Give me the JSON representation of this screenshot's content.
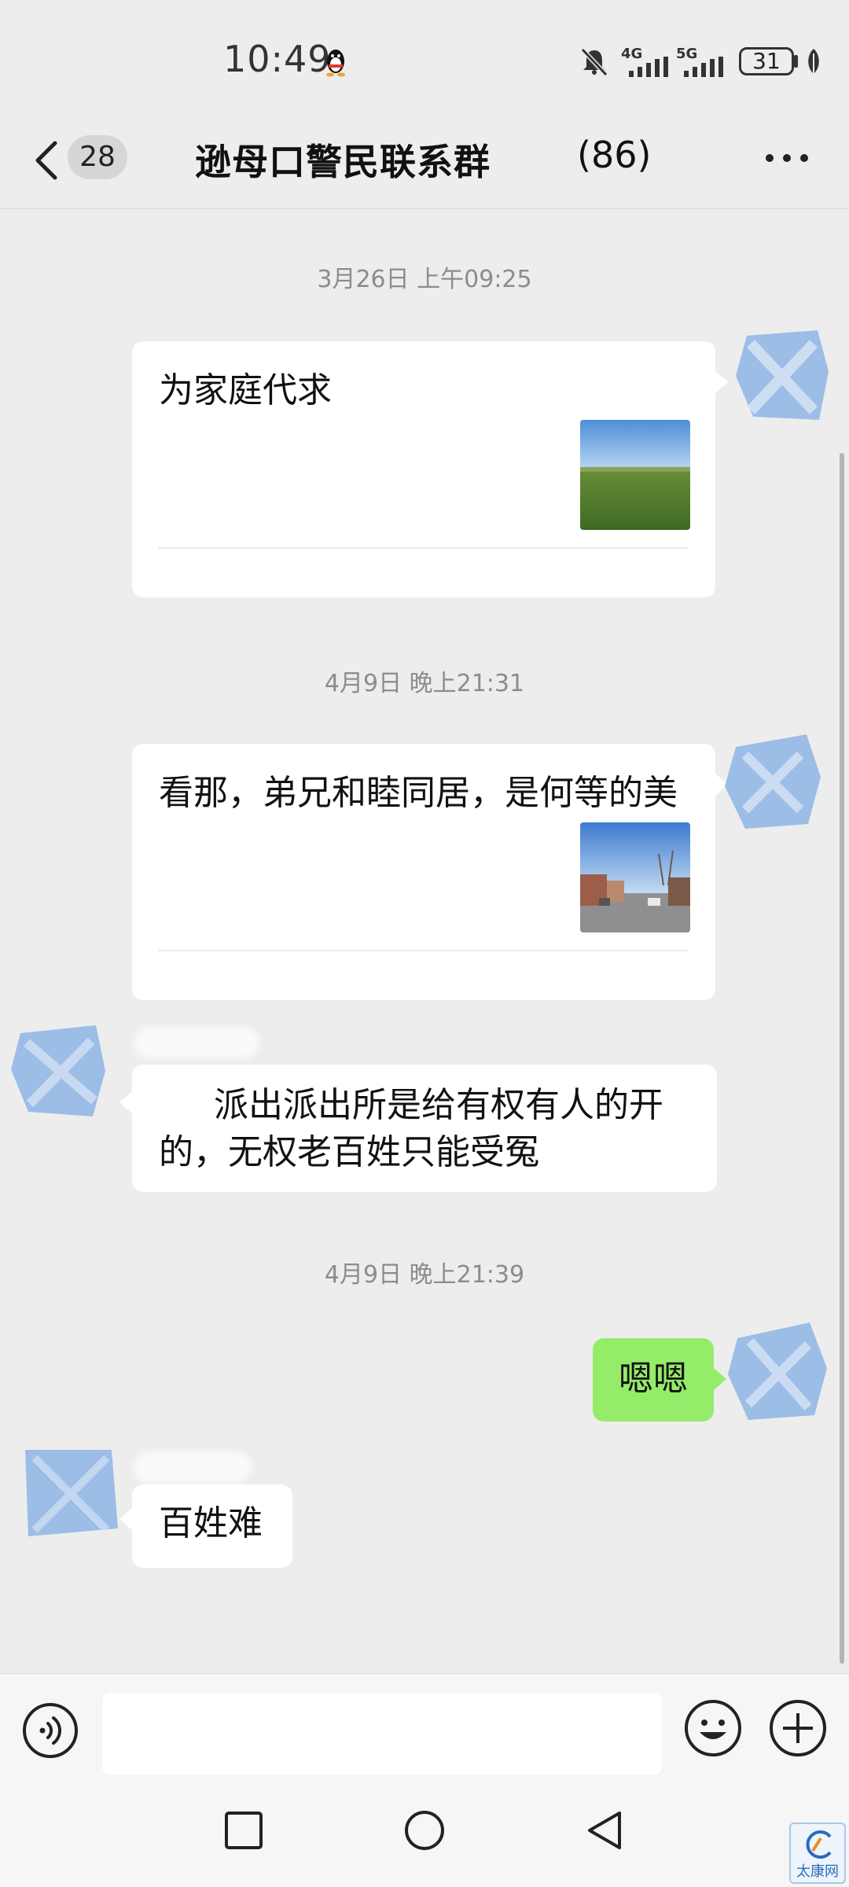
{
  "status_bar": {
    "time": "10:49",
    "network_1": "4G",
    "network_2": "5G",
    "battery": "31"
  },
  "header": {
    "unread_count": "28",
    "group_name": "逊母口警民联系群",
    "member_count": "(86)"
  },
  "messages": {
    "time_1": "3月26日 上午09:25",
    "card_1_title": "为家庭代求",
    "time_2": "4月9日 晚上21:31",
    "card_2_title": "看那，弟兄和睦同居，是何等的美",
    "text_3_line1": "派出派出所是给有权有人的开",
    "text_3_line2": "的，无权老百姓只能受冤",
    "time_3": "4月9日 晚上21:39",
    "text_4": "嗯嗯",
    "text_5": "百姓难"
  },
  "input_bar": {
    "placeholder": ""
  },
  "watermark": {
    "label": "太康网"
  },
  "colors": {
    "background": "#ededed",
    "outgoing_bubble": "#95ec69",
    "incoming_bubble": "#ffffff",
    "avatar_blur": "#9cbde6"
  },
  "icons": [
    "qq-penguin-icon",
    "mute-bell-icon",
    "signal-icon",
    "battery-icon",
    "leaf-icon",
    "back-chevron-icon",
    "more-dots-icon",
    "voice-icon",
    "emoji-icon",
    "plus-icon",
    "recent-apps-icon",
    "home-icon",
    "back-triangle-icon"
  ]
}
